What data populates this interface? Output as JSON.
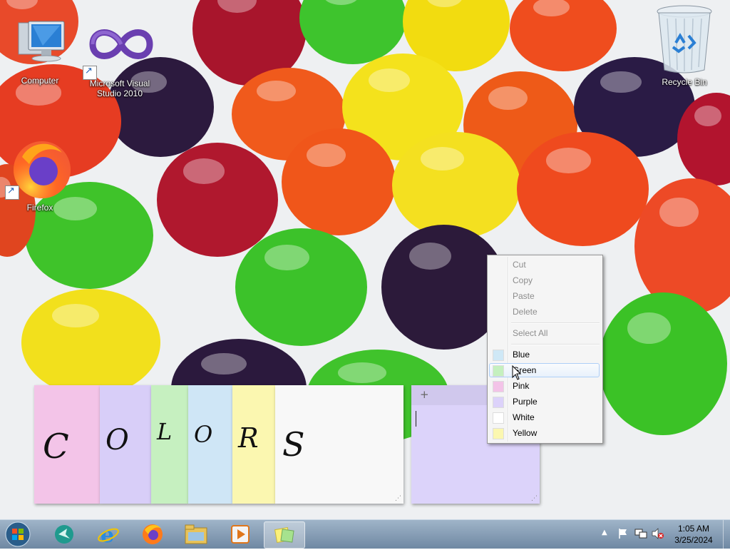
{
  "desktop": {
    "icons": [
      {
        "label": "Computer",
        "icon": "computer-icon"
      },
      {
        "label": "Microsoft Visual Studio 2010",
        "icon": "visual-studio-icon"
      },
      {
        "label": "Firefox",
        "icon": "firefox-icon"
      },
      {
        "label": "Recycle Bin",
        "icon": "recycle-bin-icon"
      }
    ]
  },
  "notes": [
    {
      "color": "#f3c4e8",
      "text": "C"
    },
    {
      "color": "#d8cef8",
      "text": "O"
    },
    {
      "color": "#c6f0c0",
      "text": "L"
    },
    {
      "color": "#cfe6f6",
      "text": "O"
    },
    {
      "color": "#fbf7b0",
      "text": "R"
    },
    {
      "color": "#f8f8f8",
      "text": "S"
    },
    {
      "color": "#dcd3fa",
      "text": "",
      "add_label": "+"
    }
  ],
  "context_menu": {
    "items": [
      {
        "label": "Cut",
        "enabled": false
      },
      {
        "label": "Copy",
        "enabled": false
      },
      {
        "label": "Paste",
        "enabled": false
      },
      {
        "label": "Delete",
        "enabled": false
      },
      {
        "label": "Select All",
        "enabled": false
      },
      {
        "label": "Blue",
        "swatch": "#cfe8f6"
      },
      {
        "label": "Green",
        "swatch": "#c5f0bf",
        "highlighted": true
      },
      {
        "label": "Pink",
        "swatch": "#f3c3e8"
      },
      {
        "label": "Purple",
        "swatch": "#dcd2fa"
      },
      {
        "label": "White",
        "swatch": "#ffffff"
      },
      {
        "label": "Yellow",
        "swatch": "#fbf7b0"
      }
    ]
  },
  "taskbar": {
    "start": "start-orb-icon",
    "apps": [
      "app-icon",
      "internet-explorer-icon",
      "firefox-icon",
      "windows-explorer-icon",
      "media-player-icon",
      "sticky-notes-icon"
    ],
    "clock": {
      "time": "1:05 AM",
      "date": "3/25/2024"
    }
  },
  "colors": {
    "accent": "#aecff7",
    "taskbar": "#7f98b1"
  }
}
